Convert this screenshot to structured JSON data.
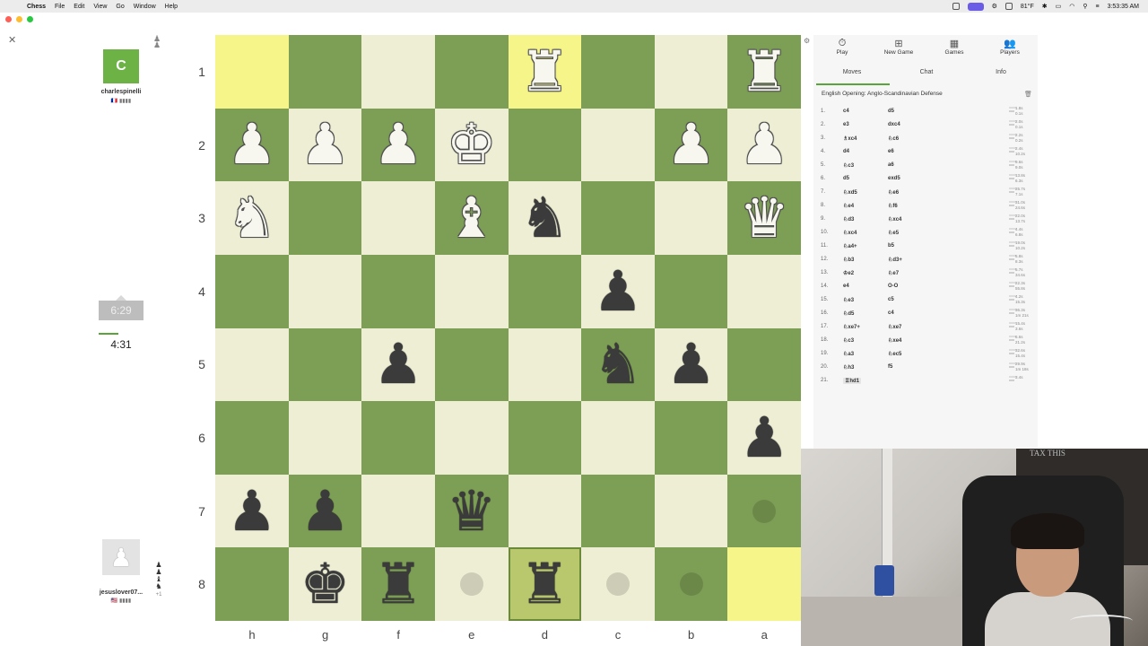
{
  "menubar": {
    "app": "Chess",
    "items": [
      "File",
      "Edit",
      "View",
      "Go",
      "Window",
      "Help"
    ],
    "weather": "81°F",
    "time": "3:53:35 AM"
  },
  "players": {
    "top": {
      "initial": "C",
      "name": "charlespinelli",
      "flag": "🇫🇷 ▮▮▮▮",
      "clock": "6:29"
    },
    "bottom": {
      "name": "jesuslover07...",
      "flag": "🇺🇸 ▮▮▮▮",
      "clock": "4:31",
      "captured_plus": "+1"
    }
  },
  "ranks": [
    "1",
    "2",
    "3",
    "4",
    "5",
    "6",
    "7",
    "8"
  ],
  "files": [
    "h",
    "g",
    "f",
    "e",
    "d",
    "c",
    "b",
    "a"
  ],
  "board": [
    [
      {
        "t": "hl-light"
      },
      {
        "t": "dark"
      },
      {
        "t": "light"
      },
      {
        "t": "dark"
      },
      {
        "t": "hl-light",
        "p": "♜",
        "c": "w"
      },
      {
        "t": "dark"
      },
      {
        "t": "light"
      },
      {
        "t": "dark",
        "p": "♜",
        "c": "w"
      }
    ],
    [
      {
        "t": "dark",
        "p": "♟",
        "c": "w"
      },
      {
        "t": "light",
        "p": "♟",
        "c": "w"
      },
      {
        "t": "dark",
        "p": "♟",
        "c": "w"
      },
      {
        "t": "light",
        "p": "♚",
        "c": "w"
      },
      {
        "t": "dark"
      },
      {
        "t": "light"
      },
      {
        "t": "dark",
        "p": "♟",
        "c": "w"
      },
      {
        "t": "light",
        "p": "♟",
        "c": "w"
      }
    ],
    [
      {
        "t": "light",
        "p": "♞",
        "c": "w"
      },
      {
        "t": "dark"
      },
      {
        "t": "light"
      },
      {
        "t": "dark",
        "p": "♝",
        "c": "w"
      },
      {
        "t": "light",
        "p": "♞",
        "c": "b"
      },
      {
        "t": "dark"
      },
      {
        "t": "light"
      },
      {
        "t": "dark",
        "p": "♛",
        "c": "w"
      }
    ],
    [
      {
        "t": "dark"
      },
      {
        "t": "light"
      },
      {
        "t": "dark"
      },
      {
        "t": "light"
      },
      {
        "t": "dark"
      },
      {
        "t": "light",
        "p": "♟",
        "c": "b"
      },
      {
        "t": "dark"
      },
      {
        "t": "light"
      }
    ],
    [
      {
        "t": "light"
      },
      {
        "t": "dark"
      },
      {
        "t": "light",
        "p": "♟",
        "c": "b"
      },
      {
        "t": "dark"
      },
      {
        "t": "light"
      },
      {
        "t": "dark",
        "p": "♞",
        "c": "b"
      },
      {
        "t": "light",
        "p": "♟",
        "c": "b"
      },
      {
        "t": "dark"
      }
    ],
    [
      {
        "t": "dark"
      },
      {
        "t": "light"
      },
      {
        "t": "dark"
      },
      {
        "t": "light"
      },
      {
        "t": "dark"
      },
      {
        "t": "light"
      },
      {
        "t": "dark"
      },
      {
        "t": "light",
        "p": "♟",
        "c": "b"
      }
    ],
    [
      {
        "t": "light",
        "p": "♟",
        "c": "b"
      },
      {
        "t": "dark",
        "p": "♟",
        "c": "b"
      },
      {
        "t": "light"
      },
      {
        "t": "dark",
        "p": "♛",
        "c": "b"
      },
      {
        "t": "light"
      },
      {
        "t": "dark"
      },
      {
        "t": "light"
      },
      {
        "t": "dark",
        "dot": true
      }
    ],
    [
      {
        "t": "dark"
      },
      {
        "t": "light",
        "p": "♚",
        "c": "b"
      },
      {
        "t": "dark",
        "p": "♜",
        "c": "b"
      },
      {
        "t": "light",
        "dot": true
      },
      {
        "t": "selected",
        "p": "♜",
        "c": "b",
        "box": true
      },
      {
        "t": "light",
        "dot": true
      },
      {
        "t": "dark",
        "dot": true
      },
      {
        "t": "hl-light"
      }
    ]
  ],
  "nav": [
    {
      "label": "Play",
      "icon": "⏱",
      "name": "play"
    },
    {
      "label": "New Game",
      "icon": "⊞",
      "name": "new-game"
    },
    {
      "label": "Games",
      "icon": "▦",
      "name": "games"
    },
    {
      "label": "Players",
      "icon": "👥",
      "name": "players"
    }
  ],
  "subtabs": [
    "Moves",
    "Chat",
    "Info"
  ],
  "opening": "English Opening: Anglo-Scandinavian Defense",
  "moves": [
    {
      "n": "1.",
      "w": "c4",
      "b": "d5",
      "t": "1.8s\n0.1s"
    },
    {
      "n": "2.",
      "w": "e3",
      "b": "dxc4",
      "t": "2.0s\n0.1s"
    },
    {
      "n": "3.",
      "w": "♗xc4",
      "b": "♘c6",
      "t": "2.2s\n0.2s"
    },
    {
      "n": "4.",
      "w": "d4",
      "b": "e6",
      "t": "2.4s\n10.2s"
    },
    {
      "n": "5.",
      "w": "♘c3",
      "b": "a6",
      "t": "9.6s\n9.0s"
    },
    {
      "n": "6.",
      "w": "d5",
      "b": "exd5",
      "t": "13.8s\n6.3s"
    },
    {
      "n": "7.",
      "w": "♘xd5",
      "b": "♘e6",
      "t": "25.7s\n7.1s"
    },
    {
      "n": "8.",
      "w": "♘e4",
      "b": "♘f6",
      "t": "31.0s\n24.6s"
    },
    {
      "n": "9.",
      "w": "♘d3",
      "b": "♘xc4",
      "t": "22.0s\n13.7s"
    },
    {
      "n": "10.",
      "w": "♘xc4",
      "b": "♘e5",
      "t": "4.4s\n6.8s"
    },
    {
      "n": "11.",
      "w": "♘a4+",
      "b": "b5",
      "t": "19.0s\n10.2s"
    },
    {
      "n": "12.",
      "w": "♘b3",
      "b": "♘d3+",
      "t": "5.8s\n8.3s"
    },
    {
      "n": "13.",
      "w": "♔e2",
      "b": "♘e7",
      "t": "5.7s\n34.6s"
    },
    {
      "n": "14.",
      "w": "e4",
      "b": "O-O",
      "t": "22.3s\n55.8s"
    },
    {
      "n": "15.",
      "w": "♘e3",
      "b": "c5",
      "t": "4.2s\n15.3s"
    },
    {
      "n": "16.",
      "w": "♘d5",
      "b": "c4",
      "t": "36.3s\n1m 21s"
    },
    {
      "n": "17.",
      "w": "♘xe7+",
      "b": "♘xe7",
      "t": "15.4s\n3.6s"
    },
    {
      "n": "18.",
      "w": "♘c3",
      "b": "♘xe4",
      "t": "6.6s\n21.2s"
    },
    {
      "n": "19.",
      "w": "♘a3",
      "b": "♘ec5",
      "t": "32.6s\n15.4s"
    },
    {
      "n": "20.",
      "w": "♘h3",
      "b": "f5",
      "t": "29.9s\n1m 18s"
    },
    {
      "n": "21.",
      "w": "♖hd1",
      "b": "",
      "t": "3.4s"
    }
  ],
  "webcam": {
    "poster_text": "TAX THIS"
  }
}
